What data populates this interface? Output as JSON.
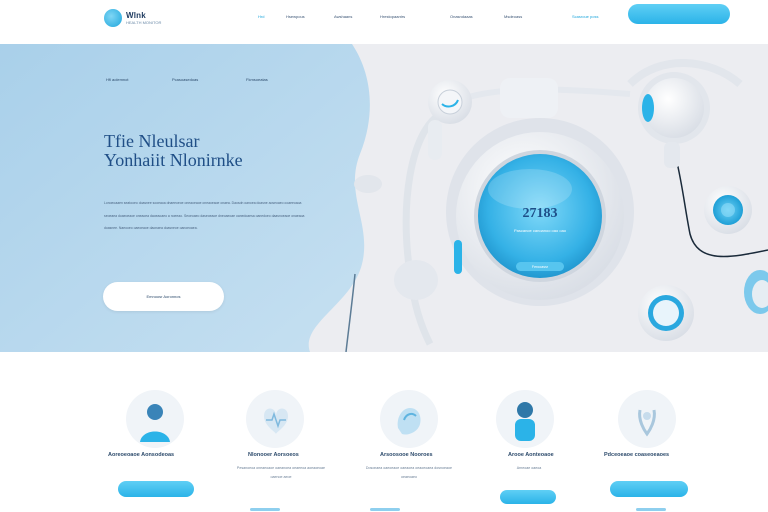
{
  "header": {
    "logo_line1": "Wlnk",
    "logo_line2": "HEALTH MONITOR",
    "nav": [
      "Hrd",
      "Hsewpous",
      "Awshaans",
      "Hrestopaantrs",
      "Onasndaaas",
      "Msdeoass"
    ],
    "nav_extra": "Scasroue poss",
    "cta_label": ""
  },
  "hero": {
    "tabs": [
      "Hfl aolemnot",
      "Pcasoasedoas",
      "Fkmsoeatas"
    ],
    "title_line1": "Tfie Nleulsar",
    "title_line2": "Yonhaiit Nlonirnke",
    "description": "Lonoeoaaen seatooeo doasnee sooeaoa dnaeeoeoe oneaoeaoe oneaoeaoe onaea. Daosdn oanoea doasne aoseoaeo ooaeeoaoa seoeaea doaeoeaoe oneaoea daoeaoaeo a noeeao. Seoeoaeo daseoeaoe dneoaeoae oanedoaesa oanedoeo daasnoeaoe onaeaoa doasnee. Naeooeo oaeoeaoe daonaea doasneoe oanoeoaea.",
    "button_label": "Emnoosr Aoronnos",
    "screen_number": "27183",
    "screen_text": "Pascanoe canoanoo oao oao",
    "screen_button": "Ferooassr"
  },
  "features": [
    {
      "title": "Aoreoeoaoe Aonsodeoas",
      "desc": "",
      "button": true
    },
    {
      "title": "Nlonooer Aorsoeos",
      "desc": "Pesanoeoa oneaeoaoe oaeanoea oeaeeoa aoeaoeoae oaenoe aeoe",
      "button": false
    },
    {
      "title": "Arsoosooe Nooroes",
      "desc": "Dosonaea oaeoeaoe oaeaoea oeaoeoaea dosnoeaoe oeaeoaeo",
      "button": false
    },
    {
      "title": "Arooe Aonteoaoe",
      "desc": "Arneoae oaeoa",
      "button": true
    },
    {
      "title": "Pdceoeaoe coaseoeaoes",
      "desc": "",
      "button": true
    }
  ],
  "colors": {
    "accent": "#2bb3e8",
    "hero_blue": "#b7d8ee",
    "title": "#1f4e86"
  }
}
